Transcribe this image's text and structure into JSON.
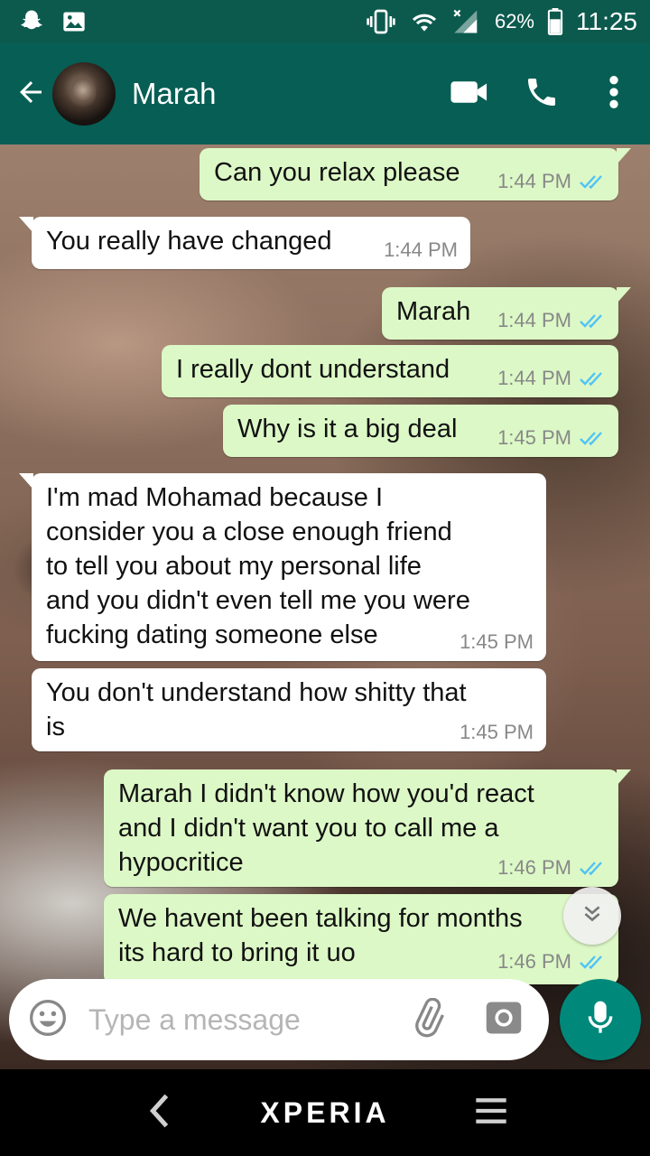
{
  "status_bar": {
    "battery": "62%",
    "time": "11:25",
    "icons": [
      "snapchat-icon",
      "image-icon",
      "vibrate-icon",
      "wifi-icon",
      "signal-icon",
      "battery-icon"
    ]
  },
  "header": {
    "contact_name": "Marah",
    "icons": [
      "back-arrow-icon",
      "video-call-icon",
      "phone-icon",
      "more-vert-icon"
    ]
  },
  "messages": [
    {
      "dir": "out",
      "text": "Can you relax please",
      "time": "1:44 PM",
      "read": true
    },
    {
      "dir": "in",
      "text": "You really have changed",
      "time": "1:44 PM"
    },
    {
      "dir": "out",
      "text": "Marah",
      "time": "1:44 PM",
      "read": true
    },
    {
      "dir": "out",
      "text": "I really dont understand",
      "time": "1:44 PM",
      "read": true
    },
    {
      "dir": "out",
      "text": "Why is it a big deal",
      "time": "1:45 PM",
      "read": true
    },
    {
      "dir": "in",
      "text": "I'm mad Mohamad because I\nconsider you a close enough friend\nto tell you about my personal life\nand you didn't even tell me you were\nfucking dating someone else",
      "time": "1:45 PM"
    },
    {
      "dir": "in",
      "text": "You don't understand how shitty that\nis",
      "time": "1:45 PM"
    },
    {
      "dir": "out",
      "text": "Marah I didn't know how you'd react\nand I didn't want you to call me a\nhypocritice",
      "time": "1:46 PM",
      "read": true
    },
    {
      "dir": "out",
      "text": "We havent been talking for months\nits hard to bring it uo",
      "time": "1:46 PM",
      "read": true
    }
  ],
  "input": {
    "placeholder": "Type a message"
  },
  "nav": {
    "brand": "XPERIA"
  },
  "colors": {
    "header": "#075e54",
    "status": "#0c5a4e",
    "outgoing": "#dcf8c6",
    "incoming": "#ffffff",
    "read_tick": "#4fc3f7",
    "mic": "#00897b"
  }
}
